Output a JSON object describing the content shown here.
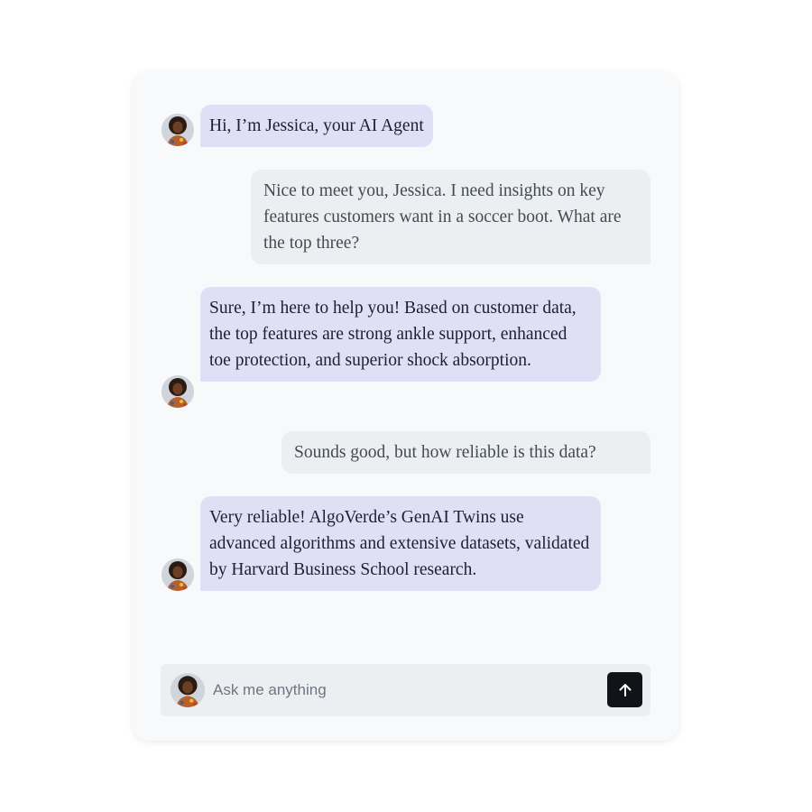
{
  "chat": {
    "messages": [
      {
        "role": "agent",
        "text": "Hi, I’m Jessica, your AI Agent"
      },
      {
        "role": "user",
        "text": "Nice to meet you, Jessica. I need insights on key features customers want in a soccer boot. What are the top three?"
      },
      {
        "role": "agent",
        "text": "Sure, I’m here to help you! Based on customer data, the top features are strong ankle support, enhanced toe protection, and superior shock absorption."
      },
      {
        "role": "user",
        "text": "Sounds good, but how reliable is this data?"
      },
      {
        "role": "agent",
        "text": "Very reliable! AlgoVerde’s GenAI Twins use advanced algorithms and extensive datasets, validated by Harvard Business School research."
      }
    ]
  },
  "composer": {
    "placeholder": "Ask me anything",
    "value": "",
    "send_icon": "arrow-up-icon"
  },
  "colors": {
    "agent_bubble": "#dfdff6",
    "user_bubble": "#eceff1",
    "send_button": "#101418",
    "card_background": "#f8f9fb"
  }
}
